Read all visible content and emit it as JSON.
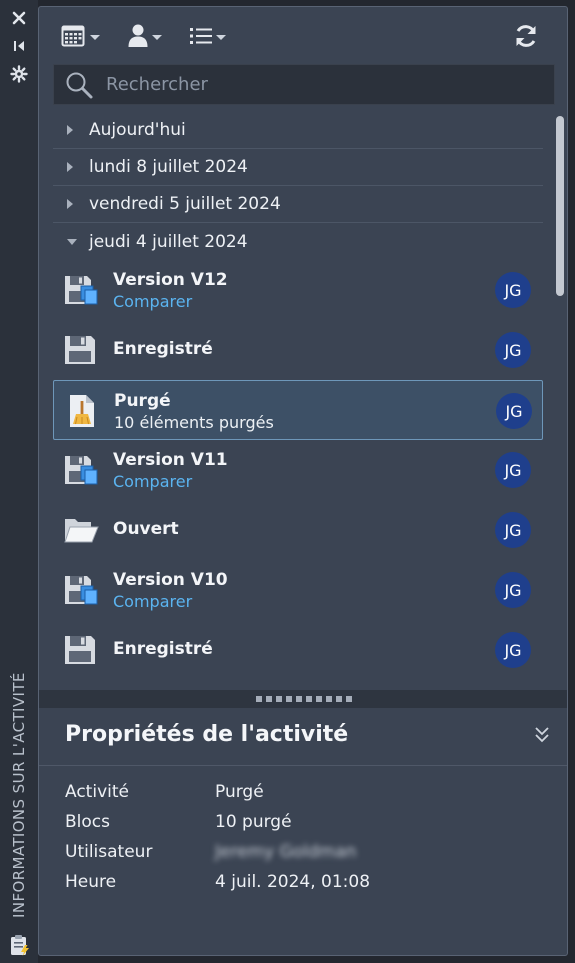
{
  "sidebar_title": "INFORMATIONS SUR L'ACTIVITÉ",
  "search": {
    "placeholder": "Rechercher"
  },
  "groups": [
    {
      "label": "Aujourd'hui",
      "expanded": false
    },
    {
      "label": "lundi 8 juillet 2024",
      "expanded": false
    },
    {
      "label": "vendredi 5 juillet 2024",
      "expanded": false
    },
    {
      "label": "jeudi 4 juillet 2024",
      "expanded": true
    }
  ],
  "items": [
    {
      "title": "Version V12",
      "subtitle": "Comparer",
      "icon": "save-version-icon",
      "user": "JG"
    },
    {
      "title": "Enregistré",
      "subtitle": "",
      "icon": "save-icon",
      "user": "JG"
    },
    {
      "title": "Purgé",
      "subtitle": "10 éléments purgés",
      "icon": "purge-icon",
      "user": "JG"
    },
    {
      "title": "Version V11",
      "subtitle": "Comparer",
      "icon": "save-version-icon",
      "user": "JG"
    },
    {
      "title": "Ouvert",
      "subtitle": "",
      "icon": "open-folder-icon",
      "user": "JG"
    },
    {
      "title": "Version V10",
      "subtitle": "Comparer",
      "icon": "save-version-icon",
      "user": "JG"
    },
    {
      "title": "Enregistré",
      "subtitle": "",
      "icon": "save-icon",
      "user": "JG"
    }
  ],
  "properties": {
    "title": "Propriétés de l'activité",
    "rows": [
      {
        "key": "Activité",
        "value": "Purgé"
      },
      {
        "key": "Blocs",
        "value": "10 purgé"
      },
      {
        "key": "Utilisateur",
        "value": "Jeremy Goldman"
      },
      {
        "key": "Heure",
        "value": "4 juil. 2024, 01:08"
      }
    ]
  },
  "colors": {
    "accent_link": "#5bb4f0",
    "avatar_bg": "#1f3f8c",
    "selection_border": "#6e97b9"
  }
}
